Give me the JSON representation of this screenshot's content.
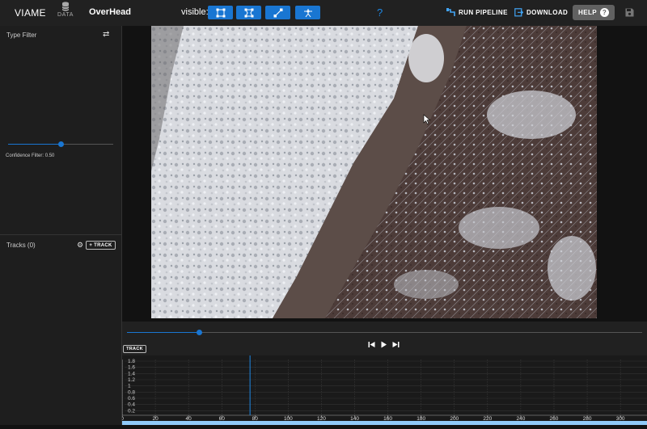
{
  "topbar": {
    "app_title": "VIAME",
    "data_label": "DATA",
    "dataset_name": "OverHead",
    "visible_label": "visible:",
    "visibility_buttons": [
      {
        "icon": "bounding-box-icon"
      },
      {
        "icon": "polygon-icon"
      },
      {
        "icon": "line-icon"
      },
      {
        "icon": "keypoint-icon"
      }
    ],
    "help_question": "?",
    "run_pipeline_label": "RUN PIPELINE",
    "download_label": "DOWNLOAD",
    "help_label": "HELP",
    "help_circle": "?"
  },
  "sidebar": {
    "type_filter_title": "Type Filter",
    "confidence_label": "Confidence Filter: 0.50",
    "confidence_value": 0.5,
    "tracks_title": "Tracks (0)",
    "add_track_label": "+ TRACK"
  },
  "controls": {
    "track_chip_label": "TRACK",
    "frame_fraction": 0.14
  },
  "timeline": {
    "y_ticks": [
      "1.8",
      "1.6",
      "1.4",
      "1.2",
      "1",
      "0.8",
      "0.6",
      "0.4",
      "0.2"
    ],
    "x_ticks": [
      "0",
      "20",
      "40",
      "60",
      "80",
      "100",
      "120",
      "140",
      "160",
      "180",
      "200",
      "220",
      "240",
      "260",
      "280",
      "300"
    ],
    "current_frame": 77,
    "max_frame": 316
  },
  "colors": {
    "accent": "#1976d2",
    "topbar": "#212121",
    "sidebar": "#1e1e1e"
  }
}
